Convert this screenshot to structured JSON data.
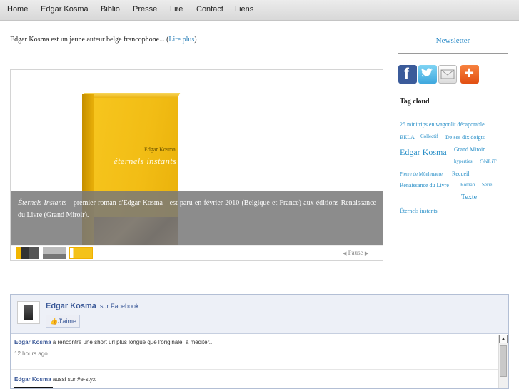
{
  "nav": {
    "items": [
      "Home",
      "Edgar Kosma",
      "Biblio",
      "Presse",
      "Lire",
      "Contact",
      "Liens"
    ]
  },
  "intro": {
    "text": "Edgar Kosma est un jeune auteur belge francophone... (",
    "link": "Lire plus",
    "close": ")"
  },
  "slideshow": {
    "book_author": "Edgar Kosma",
    "book_title": "éternels instants",
    "caption_title": "Éternels Instants",
    "caption_text": " - premier roman d'Edgar Kosma - est paru en février 2010 (Belgique et France) aux éditions Renaissance du Livre (Grand Miroir).",
    "pause_label": "Pause",
    "prev_arrow": "◀",
    "next_arrow": "▶"
  },
  "sidebar": {
    "newsletter_label": "Newsletter",
    "share_icons": [
      "facebook-icon",
      "twitter-icon",
      "mail-icon",
      "plus-icon"
    ],
    "tagcloud_title": "Tag cloud",
    "tags": [
      "25 minitrips en wagonlit décapotable",
      "BELA",
      "Collectif",
      "De ses dix doigts",
      "Edgar Kosma",
      "Grand Miroir",
      "hyperties",
      "ONLiT",
      "Pierre de Mûelenaere",
      "Recueil",
      "Renaissance du Livre",
      "Roman",
      "Série",
      "Texte",
      "Éternels instants"
    ]
  },
  "facebook": {
    "page_name": "Edgar Kosma",
    "sur": "sur Facebook",
    "like_label": "J'aime",
    "posts": [
      {
        "author": "Edgar Kosma",
        "text": " a rencontré une short url plus longue que l'originale. à méditer...",
        "time": "12 hours ago"
      },
      {
        "author": "Edgar Kosma",
        "text": " aussi sur #e-styx",
        "time": ""
      }
    ]
  },
  "colors": {
    "link": "#2a90c8",
    "facebook_blue": "#3b5998",
    "caption_bg": "#787878"
  }
}
